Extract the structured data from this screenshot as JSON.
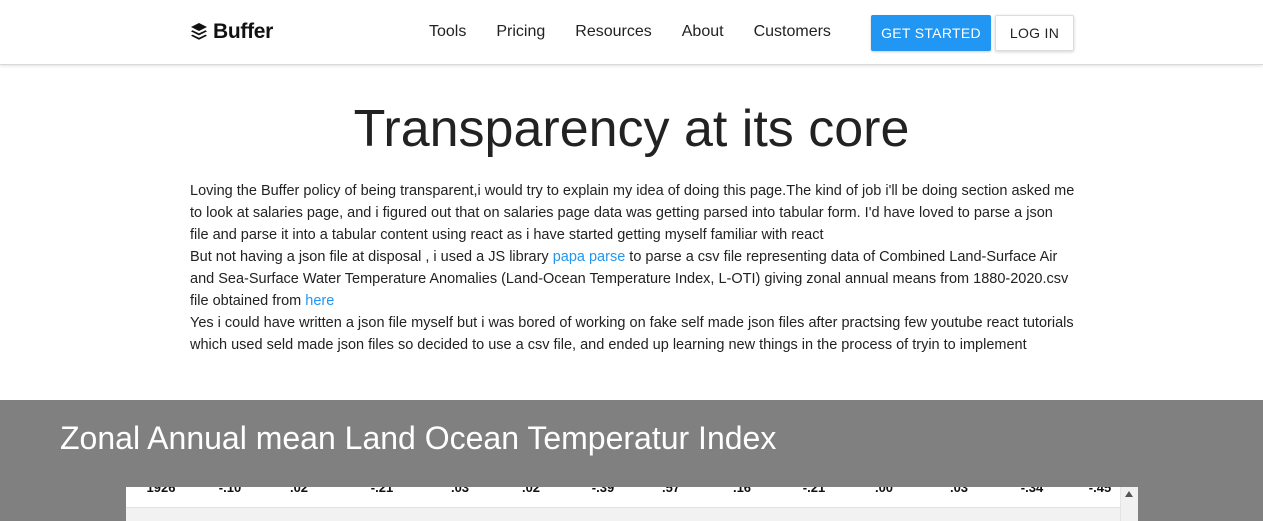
{
  "nav": {
    "logo_text": "Buffer",
    "menu": [
      "Tools",
      "Pricing",
      "Resources",
      "About",
      "Customers"
    ],
    "get_started": "GET STARTED",
    "log_in": "LOG IN"
  },
  "hero": {
    "title": "Transparency at its core",
    "p1": "Loving the Buffer policy of being transparent,i would try to explain my idea of doing this page.The kind of job i'll be doing section asked me to look at salaries page, and i figured out that on salaries page data was getting parsed into tabular form. I'd have loved to parse a json file and parse it into a tabular content using react as i have started getting myself familiar with react",
    "p2_a": "But not having a json file at disposal , i used a JS library ",
    "p2_link": "papa parse",
    "p2_b": " to parse a csv file representing data of Combined Land-Surface Air and Sea-Surface Water Temperature Anomalies (Land-Ocean Temperature Index, L-OTI) giving zonal annual means from 1880-2020.csv file obtained from ",
    "p2_link2": "here",
    "p3": "Yes i could have written a json file myself but i was bored of working on fake self made json files after practsing few youtube react tutorials which used seld made json files so decided to use a csv file, and ended up learning new things in the process of tryin to implement"
  },
  "section": {
    "title": "Zonal Annual mean Land Ocean Temperatur Index"
  },
  "table": {
    "visible_row": [
      "1926",
      "-.10",
      ".02",
      "-.21",
      ".03",
      ".02",
      "-.39",
      ".57",
      ".16",
      "-.21",
      ".00",
      ".03",
      "-.34",
      "-.45"
    ]
  },
  "colors": {
    "accent": "#2196f3",
    "section_bg": "#808080"
  }
}
